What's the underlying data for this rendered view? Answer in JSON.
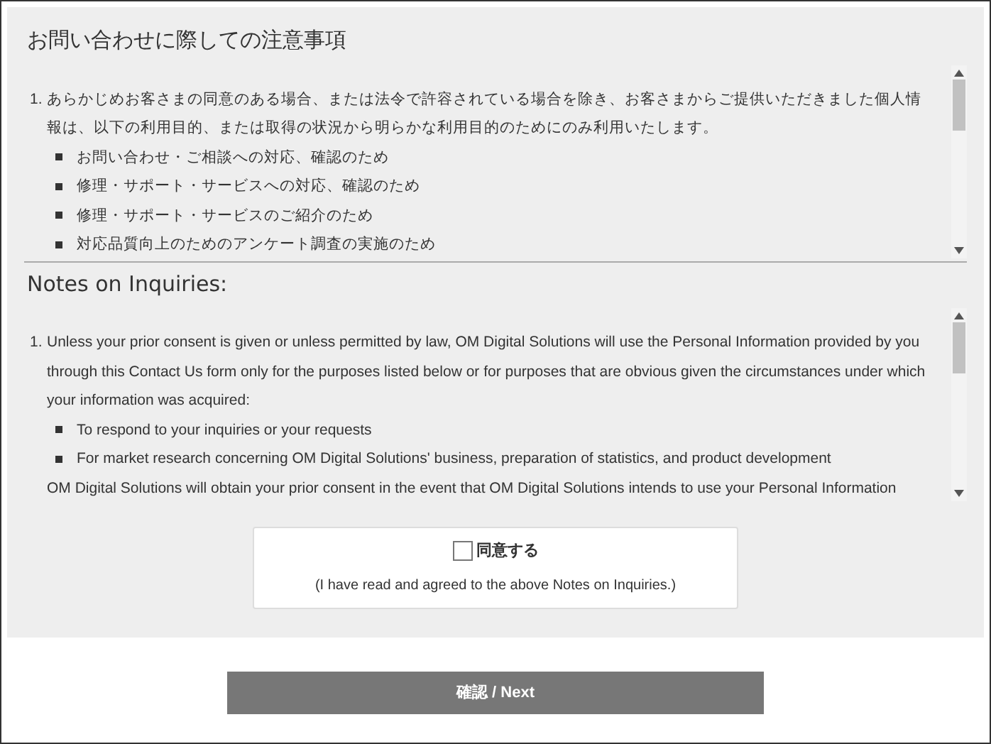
{
  "sections": [
    {
      "title": "お問い合わせに際しての注意事項",
      "blocks": [
        {
          "kind": "numbered",
          "number": "1.",
          "text": "あらかじめお客さまの同意のある場合、または法令で許容されている場合を除き、お客さまからご提供いただきました個人情報は、以下の利用目的、または取得の状況から明らかな利用目的のためにのみ利用いたします。"
        },
        {
          "kind": "bullet",
          "text": "お問い合わせ・ご相談への対応、確認のため"
        },
        {
          "kind": "bullet",
          "text": "修理・サポート・サービスへの対応、確認のため"
        },
        {
          "kind": "bullet",
          "text": "修理・サポート・サービスのご紹介のため"
        },
        {
          "kind": "bullet",
          "text": "対応品質向上のためのアンケート調査の実施のため"
        }
      ]
    },
    {
      "title": "Notes on Inquiries:",
      "blocks": [
        {
          "kind": "numbered",
          "number": "1.",
          "text": "Unless your prior consent is given or unless permitted by law, OM Digital Solutions will use the Personal Information provided by you through this Contact Us form only for the purposes listed below or for purposes that are obvious given the circumstances under which your information was acquired:"
        },
        {
          "kind": "bullet",
          "text": "To respond to your inquiries or your requests"
        },
        {
          "kind": "bullet",
          "text": "For market research concerning OM Digital Solutions' business, preparation of statistics, and product development"
        },
        {
          "kind": "paragraph",
          "text": "OM Digital Solutions will obtain your prior consent in the event that OM Digital Solutions intends to use your Personal Information"
        }
      ]
    }
  ],
  "consent": {
    "label": "同意する",
    "checked": false,
    "note": "(I have read and agreed to the above Notes on Inquiries.)"
  },
  "next_button": "確認 / Next"
}
